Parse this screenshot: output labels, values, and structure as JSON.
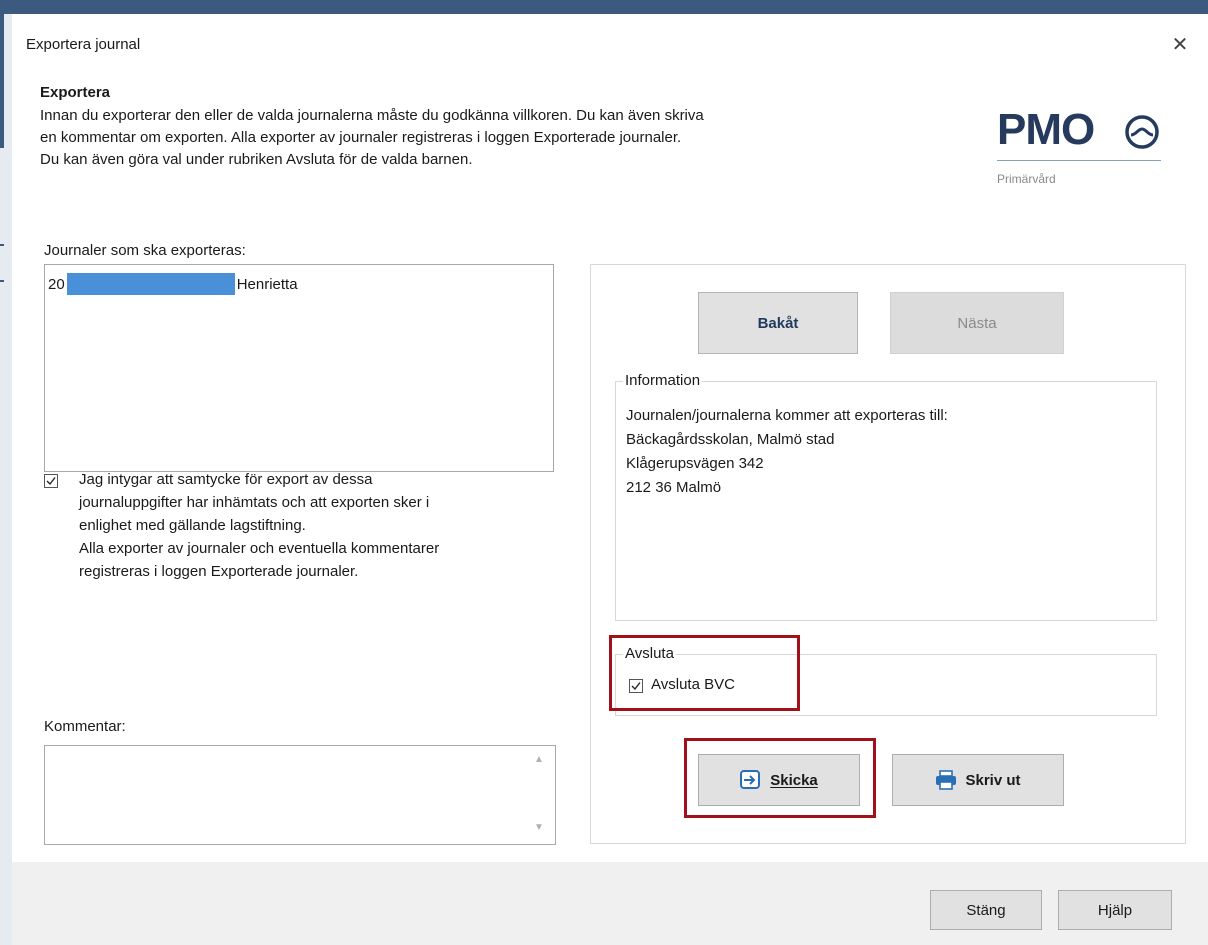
{
  "window": {
    "title": "Exportera journal",
    "close_glyph": "✕"
  },
  "header": {
    "heading": "Exportera",
    "intro_lines": [
      "Innan du exporterar den eller de valda journalerna måste du godkänna villkoren. Du kan även skriva",
      "en kommentar om exporten. Alla exporter av journaler registreras i loggen Exporterade journaler.",
      "Du kan även göra val under rubriken Avsluta för de valda barnen."
    ]
  },
  "logo": {
    "text": "PMO",
    "subtitle": "Primärvård",
    "icon": "pmo-logo-icon",
    "color": "#253a5c"
  },
  "journals": {
    "label": "Journaler som ska exporteras:",
    "items": [
      {
        "prefix": "20",
        "name": "Henrietta"
      }
    ]
  },
  "consent": {
    "checked": true,
    "lines": [
      "Jag intygar att samtycke för export av dessa",
      "journaluppgifter har inhämtats och att exporten sker i",
      "enlighet med gällande lagstiftning.",
      "Alla exporter av journaler och eventuella kommentarer",
      "registreras i loggen Exporterade journaler."
    ]
  },
  "comment": {
    "label": "Kommentar:",
    "value": ""
  },
  "nav": {
    "back_label": "Bakåt",
    "next_label": "Nästa"
  },
  "information": {
    "title": "Information",
    "lines": [
      "Journalen/journalerna kommer att exporteras till:",
      "Bäckagårdsskolan, Malmö stad",
      "Klågerupsvägen 342",
      "212 36 Malmö"
    ]
  },
  "avsluta": {
    "title": "Avsluta",
    "checkbox_label": "Avsluta BVC",
    "checked": true
  },
  "actions": {
    "send_label": "Skicka",
    "send_icon": "send-icon",
    "print_label": "Skriv ut",
    "print_icon": "printer-icon"
  },
  "footer": {
    "close_label": "Stäng",
    "help_label": "Hjälp"
  },
  "colors": {
    "highlight": "#a0111a",
    "title_bar": "#3c5a80",
    "redaction": "#4a90d9"
  }
}
